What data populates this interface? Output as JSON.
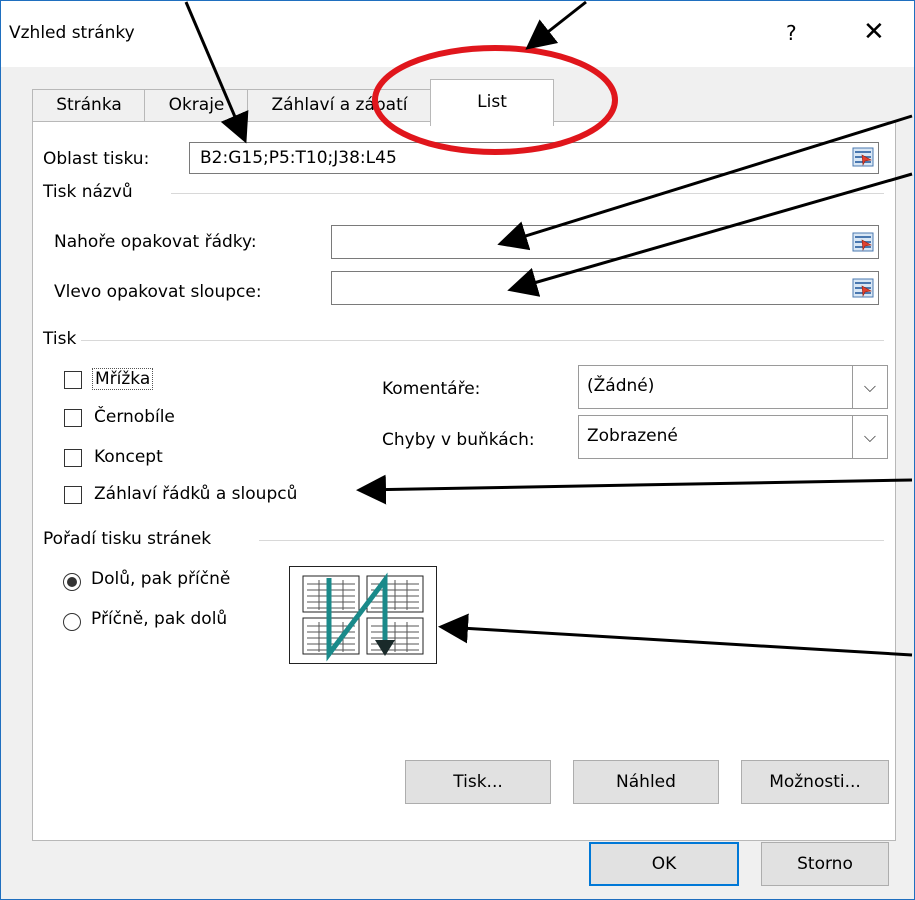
{
  "window": {
    "title": "Vzhled stránky",
    "help_label": "?",
    "close_label": "✕"
  },
  "tabs": [
    {
      "label": "Stránka"
    },
    {
      "label": "Okraje"
    },
    {
      "label": "Záhlaví a zápatí"
    },
    {
      "label": "List",
      "active": true
    }
  ],
  "print_area": {
    "label": "Oblast tisku:",
    "value": "B2:G15;P5:T10;J38:L45"
  },
  "print_titles": {
    "section": "Tisk názvů",
    "rows_label": "Nahoře opakovat řádky:",
    "rows_value": "",
    "cols_label": "Vlevo opakovat sloupce:",
    "cols_value": ""
  },
  "print": {
    "section": "Tisk",
    "gridlines": {
      "label": "Mřížka",
      "checked": false
    },
    "bw": {
      "label": "Černobíle",
      "checked": false
    },
    "draft": {
      "label": "Koncept",
      "checked": false
    },
    "headings": {
      "label": "Záhlaví řádků a sloupců",
      "checked": false
    },
    "comments_label": "Komentáře:",
    "comments_value": "(Žádné)",
    "errors_label": "Chyby v buňkách:",
    "errors_value": "Zobrazené"
  },
  "page_order": {
    "section": "Pořadí tisku stránek",
    "down_then_over": "Dolů, pak příčně",
    "over_then_down": "Příčně, pak dolů",
    "selected": "down_then_over"
  },
  "buttons": {
    "print": "Tisk...",
    "preview": "Náhled",
    "options": "Možnosti...",
    "ok": "OK",
    "cancel": "Storno"
  },
  "colors": {
    "annotation_circle": "#e0161c",
    "accent": "#0078d7",
    "order_arrow": "#1a8a8a"
  }
}
